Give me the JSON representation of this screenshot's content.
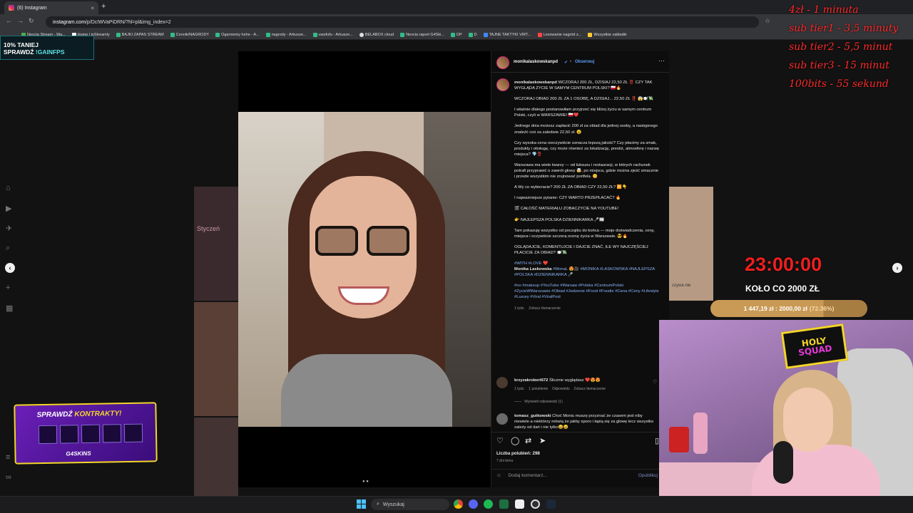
{
  "browser": {
    "tab_title": "(6) Instagram",
    "url_host": "instagram.com",
    "url_path": "/p/DcIWVaPiDRN/?hl=pl&img_index=2",
    "bookmarks": [
      "Nevcia Stream - Wa...",
      "Home | inStreamly",
      "BAJKI ZAPAS STREAM",
      "Cennik/NAGRODY",
      "Ogarniemy hehe - A...",
      "nagrody - Arkusze...",
      "uwufufu - Arkusze...",
      "BELABOX cloud",
      "Nevcia raport G4Ski...",
      "DP",
      "D",
      "TAJNE TAKTYKI VIRT...",
      "Losowanie nagród z...",
      "Wszystkie zakładki"
    ]
  },
  "post": {
    "author": "monikalaskowskanpd",
    "follow_label": "Obserwuj",
    "caption": [
      "WCZORAJ 200 ZŁ, DZISIAJ 22,50 ZŁ ‼️ CZY TAK WYGLĄDA ŻYCIE W SAMYM CENTRUM POLSKI? 🇵🇱🔥",
      "WCZORAJ OBIAD 200 ZŁ ZA 1 OSOBĘ, A DZISIAJ... 22,50 ZŁ ‼️ 😱🍽️💸",
      "I właśnie dlatego postanowiłam przyjrzeć się bliżej życiu w samym centrum Polski, czyli w WARSZAWIE! 🇵🇱❤️",
      "Jednego dnia możesz zapłacić 200 zł za obiad dla jednej osoby, a następnego znaleźć coś za zaledwie 22,50 zł. 😮",
      "Czy wysoka cena rzeczywiście oznacza lepszą jakość? Czy płacimy za smak, produkty i obsługę, czy może również za lokalizację, prestiż, atmosferę i nazwę miejsca? 💎‼️",
      "Warszawa ma wiele twarzy — od luksusu i restauracji, w których rachunek potrafi przyprawić o zawrót głowy 🤯, po miejsca, gdzie można zjeść smacznie i przede wszystkim nie zrujnować portfela. 😋",
      "A Wy co wybieracie? 200 ZŁ ZA OBIAD CZY 22,50 ZŁ? 🆚👇",
      "I najważniejsze pytanie: CZY WARTO PRZEPŁACAĆ? 🔥",
      "🎬 CAŁOŚĆ MATERIAŁU ZOBACZYCIE NA YOUTUBE!",
      "👉 NAJLEPSZA POLSKA DZIENNIKARKA 🎤📰",
      "Tam pokazuję wszystko od początku do końca — moje doświadczenia, ceny, miejsca i oczywiście szczerą ocenę życia w Warszawie. 😎🔥",
      "OGLĄDAJCIE, KOMENTUJCIE I DAJCIE ZNAĆ, ILE WY NAJCZĘŚCIEJ PŁACICIE ZA OBIAD? 🍽️💸"
    ],
    "tags_line1": "#WITH #LOVE ❤️",
    "tags_line2_name": "Monika Laskowska",
    "tags_line2_rest": "#MonaL 😍🎥 #MONIKA #LASKOWSKA #NAJLEPSZA #POLSKA #DZIENNIKARKA 🎤",
    "tags_block": "#no #makeup #YouTube #Warsaw #Polska #CentrumPolski #ZycieWWarszawie #Obiad #Jedzenie #Food #Foodie #Cena #Ceny #Lifestyle #Luxury #Viral #ViralPost",
    "caption_time": "1 tydz.",
    "see_translation": "Zobacz tłumaczenie",
    "comments": [
      {
        "user": "krzyzakrobert672",
        "text": "Ślicznie wyglądasz ❤️😍😍",
        "time": "1 tydz.",
        "likes": "1 polubienie",
        "reply": "Odpowiedz",
        "translate": "Zobacz tłumaczenie",
        "replies": "Wyświetl odpowiedzi (1)"
      },
      {
        "user": "tomasz_gutkowski",
        "text": "Choć Moniu muszę przyznać że czasem jest niby niewiele a niektórzy mówią że jakby sporo i łapią się za głowę lecz wszystko zależy od dań i nie tylko😄😄"
      }
    ],
    "likes_label": "Liczba polubień: 298",
    "posted_ago": "7 dni temu",
    "add_comment_placeholder": "Dodaj komentarz...",
    "publish_label": "Opublikuj"
  },
  "overlay": {
    "prices": [
      "4zł - 1 minuta",
      "sub tier1 - 3,5 minuty",
      "sub tier2 - 5,5 minut",
      "sub tier3 - 15 minut",
      "100bits - 55 sekund"
    ],
    "promo_line1": "10%   TANIEJ",
    "promo_line2a": "SPRAWDŹ ",
    "promo_line2b": "!GAINFPS",
    "timer": "23:00:00",
    "wheel_label": "KOŁO CO 2000 ZŁ",
    "goal_progress": "1 447,19 zł  :  2000,00 zł",
    "goal_percent": "(72.36%)",
    "goal_fraction": 0.7236,
    "holy_top": "HOLY",
    "holy_bottom": "SQUAD",
    "contracts_a": "SPRAWDŹ ",
    "contracts_b": "KONTRAKTY!",
    "contracts_brand": "G4SKINS",
    "mini_calendar_title": "Styczeń",
    "bg_card_text": "czywa nie"
  },
  "taskbar": {
    "search_placeholder": "Wyszukaj"
  },
  "colors": {
    "instagram_link": "#5a9cf8",
    "overlay_red": "#ff2a2a",
    "goal_gold": "#c99a55",
    "purple_promo": "#6a1fb8"
  }
}
